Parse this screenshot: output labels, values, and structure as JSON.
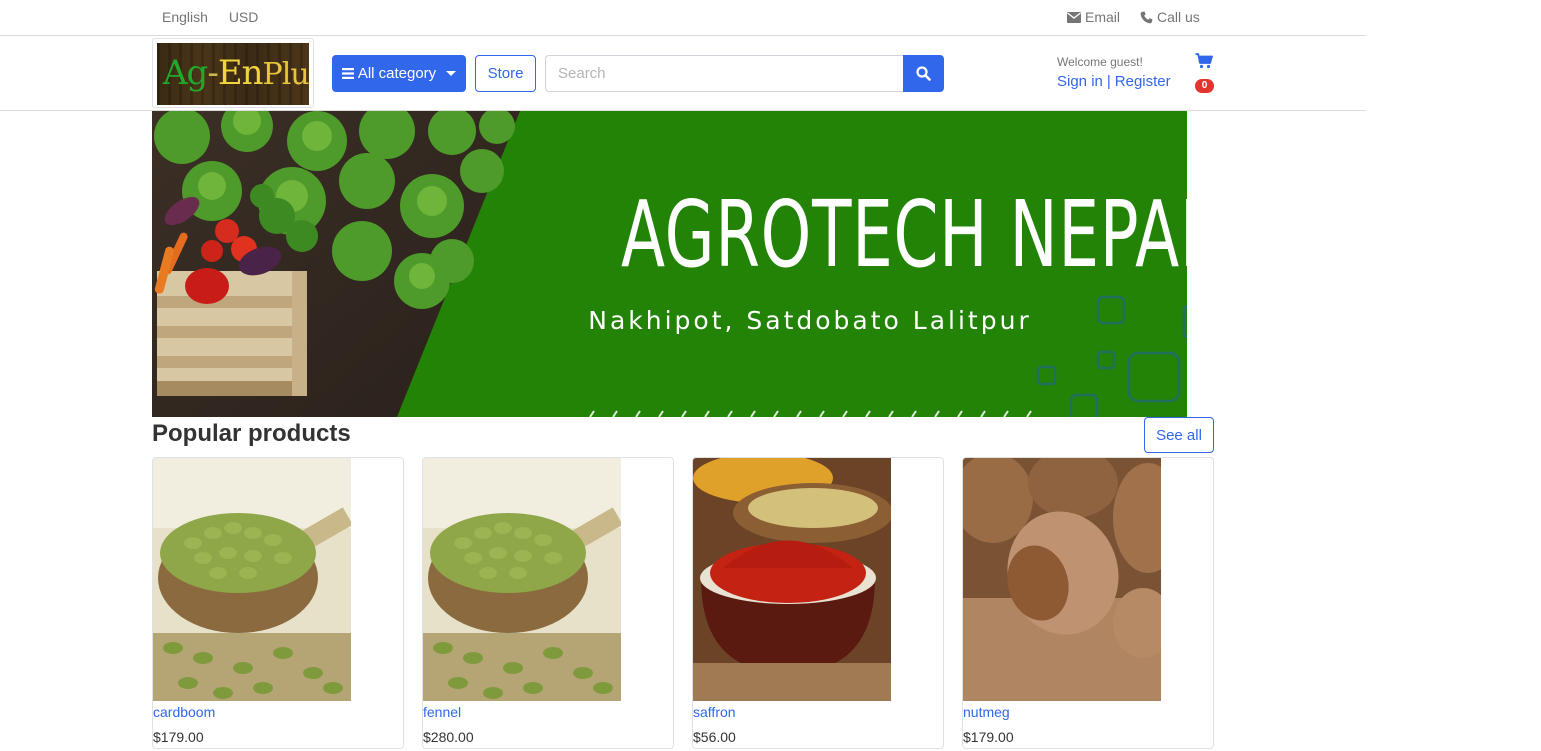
{
  "topbar": {
    "language": "English",
    "currency": "USD",
    "email_label": "Email",
    "call_label": "Call us"
  },
  "header": {
    "logo_text": {
      "ag": "Ag",
      "dash": "-",
      "en": "En",
      "plus": "Plus"
    },
    "category_label": "All category",
    "store_label": "Store",
    "search_placeholder": "Search",
    "welcome": "Welcome guest!",
    "sign_in": "Sign in",
    "separator": "|",
    "register": "Register",
    "cart_count": "0"
  },
  "banner": {
    "title": "AGROTECH NEPAL",
    "subtitle": "Nakhipot, Satdobato Lalitpur"
  },
  "popular": {
    "title": "Popular products",
    "see_all": "See all",
    "products": [
      {
        "name": "cardboom",
        "price": "$179.00"
      },
      {
        "name": "fennel",
        "price": "$280.00"
      },
      {
        "name": "saffron",
        "price": "$56.00"
      },
      {
        "name": "nutmeg",
        "price": "$179.00"
      }
    ]
  },
  "colors": {
    "primary": "#3167eb",
    "banner_green": "#238307",
    "badge_red": "#e3342f"
  }
}
